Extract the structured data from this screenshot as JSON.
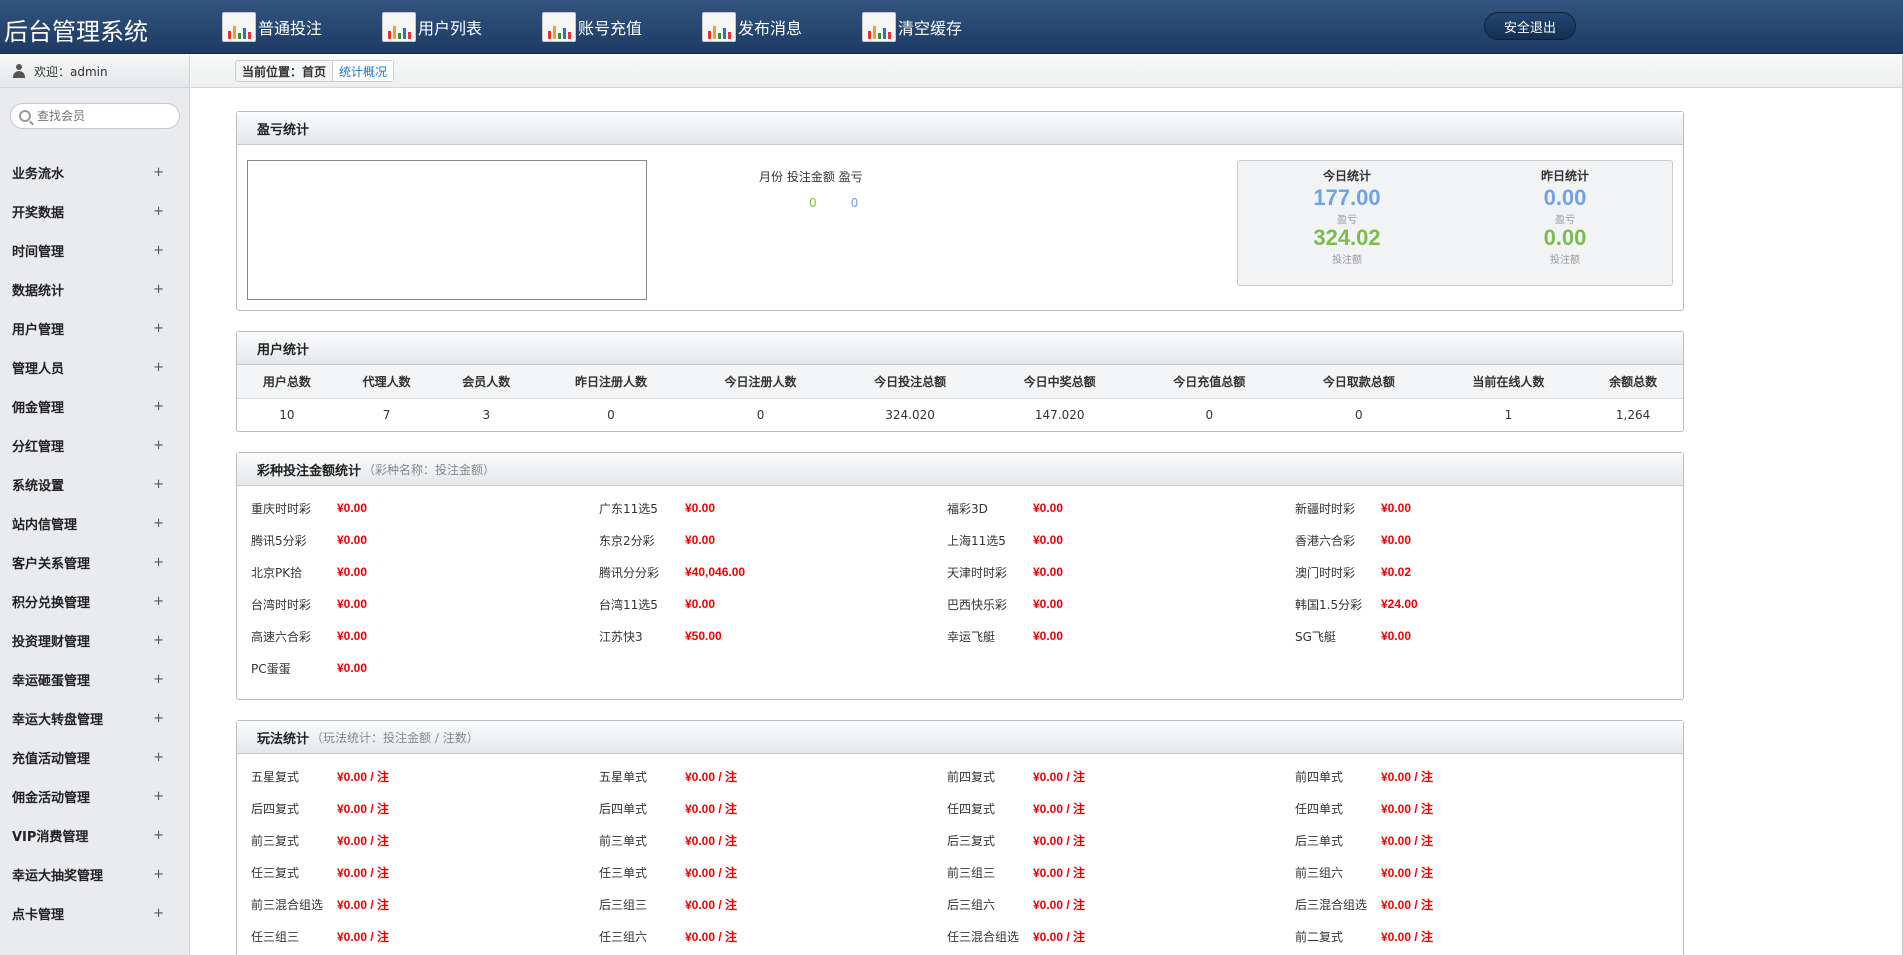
{
  "header": {
    "title": "后台管理系统",
    "nav": [
      {
        "label": "普通投注"
      },
      {
        "label": "用户列表"
      },
      {
        "label": "账号充值"
      },
      {
        "label": "发布消息"
      },
      {
        "label": "清空缓存"
      }
    ],
    "logout_label": "安全退出"
  },
  "sidebar": {
    "welcome": "欢迎：admin",
    "search_placeholder": "查找会员",
    "items": [
      {
        "label": "业务流水"
      },
      {
        "label": "开奖数据"
      },
      {
        "label": "时间管理"
      },
      {
        "label": "数据统计"
      },
      {
        "label": "用户管理"
      },
      {
        "label": "管理人员"
      },
      {
        "label": "佣金管理"
      },
      {
        "label": "分红管理"
      },
      {
        "label": "系统设置"
      },
      {
        "label": "站内信管理"
      },
      {
        "label": "客户关系管理"
      },
      {
        "label": "积分兑换管理"
      },
      {
        "label": "投资理财管理"
      },
      {
        "label": "幸运砸蛋管理"
      },
      {
        "label": "幸运大转盘管理"
      },
      {
        "label": "充值活动管理"
      },
      {
        "label": "佣金活动管理"
      },
      {
        "label": "VIP消费管理"
      },
      {
        "label": "幸运大抽奖管理"
      },
      {
        "label": "点卡管理"
      }
    ],
    "expand_symbol": "+"
  },
  "breadcrumb": {
    "prefix": "当前位置：",
    "home": "首页",
    "current": "统计概况"
  },
  "profit": {
    "title": "盈亏统计",
    "legend": "月份 投注金额 盈亏",
    "legend_bet_value": "0",
    "legend_profit_value": "0",
    "today_title": "今日统计",
    "yesterday_title": "昨日统计",
    "today_profit": "177.00",
    "today_profit_label": "盈亏",
    "today_bet": "324.02",
    "today_bet_label": "投注额",
    "yesterday_profit": "0.00",
    "yesterday_profit_label": "盈亏",
    "yesterday_bet": "0.00",
    "yesterday_bet_label": "投注额",
    "colors": {
      "profit": "#6fa3e8",
      "bet": "#7dbb4f"
    }
  },
  "users": {
    "title": "用户统计",
    "columns": [
      "用户总数",
      "代理人数",
      "会员人数",
      "昨日注册人数",
      "今日注册人数",
      "今日投注总额",
      "今日中奖总额",
      "今日充值总额",
      "今日取款总额",
      "当前在线人数",
      "余额总数"
    ],
    "values": [
      "10",
      "7",
      "3",
      "0",
      "0",
      "324.020",
      "147.020",
      "0",
      "0",
      "1",
      "1,264"
    ]
  },
  "lottery": {
    "title": "彩种投注金额统计",
    "subtitle": "（彩种名称：投注金额）",
    "items": [
      {
        "name": "重庆时时彩",
        "value": "¥0.00"
      },
      {
        "name": "广东11选5",
        "value": "¥0.00"
      },
      {
        "name": "福彩3D",
        "value": "¥0.00"
      },
      {
        "name": "新疆时时彩",
        "value": "¥0.00"
      },
      {
        "name": "腾讯5分彩",
        "value": "¥0.00"
      },
      {
        "name": "东京2分彩",
        "value": "¥0.00"
      },
      {
        "name": "上海11选5",
        "value": "¥0.00"
      },
      {
        "name": "香港六合彩",
        "value": "¥0.00"
      },
      {
        "name": "北京PK拾",
        "value": "¥0.00"
      },
      {
        "name": "腾讯分分彩",
        "value": "¥40,046.00"
      },
      {
        "name": "天津时时彩",
        "value": "¥0.00"
      },
      {
        "name": "澳门时时彩",
        "value": "¥0.02"
      },
      {
        "name": "台湾时时彩",
        "value": "¥0.00"
      },
      {
        "name": "台湾11选5",
        "value": "¥0.00"
      },
      {
        "name": "巴西快乐彩",
        "value": "¥0.00"
      },
      {
        "name": "韩国1.5分彩",
        "value": "¥24.00"
      },
      {
        "name": "高速六合彩",
        "value": "¥0.00"
      },
      {
        "name": "江苏快3",
        "value": "¥50.00"
      },
      {
        "name": "幸运飞艇",
        "value": "¥0.00"
      },
      {
        "name": "SG飞艇",
        "value": "¥0.00"
      },
      {
        "name": "PC蛋蛋",
        "value": "¥0.00"
      }
    ]
  },
  "plays": {
    "title": "玩法统计",
    "subtitle": "（玩法统计：投注金额 / 注数）",
    "items": [
      {
        "name": "五星复式",
        "value": "¥0.00 / 注"
      },
      {
        "name": "五星单式",
        "value": "¥0.00 / 注"
      },
      {
        "name": "前四复式",
        "value": "¥0.00 / 注"
      },
      {
        "name": "前四单式",
        "value": "¥0.00 / 注"
      },
      {
        "name": "后四复式",
        "value": "¥0.00 / 注"
      },
      {
        "name": "后四单式",
        "value": "¥0.00 / 注"
      },
      {
        "name": "任四复式",
        "value": "¥0.00 / 注"
      },
      {
        "name": "任四单式",
        "value": "¥0.00 / 注"
      },
      {
        "name": "前三复式",
        "value": "¥0.00 / 注"
      },
      {
        "name": "前三单式",
        "value": "¥0.00 / 注"
      },
      {
        "name": "后三复式",
        "value": "¥0.00 / 注"
      },
      {
        "name": "后三单式",
        "value": "¥0.00 / 注"
      },
      {
        "name": "任三复式",
        "value": "¥0.00 / 注"
      },
      {
        "name": "任三单式",
        "value": "¥0.00 / 注"
      },
      {
        "name": "前三组三",
        "value": "¥0.00 / 注"
      },
      {
        "name": "前三组六",
        "value": "¥0.00 / 注"
      },
      {
        "name": "前三混合组选",
        "value": "¥0.00 / 注"
      },
      {
        "name": "后三组三",
        "value": "¥0.00 / 注"
      },
      {
        "name": "后三组六",
        "value": "¥0.00 / 注"
      },
      {
        "name": "后三混合组选",
        "value": "¥0.00 / 注"
      },
      {
        "name": "任三组三",
        "value": "¥0.00 / 注"
      },
      {
        "name": "任三组六",
        "value": "¥0.00 / 注"
      },
      {
        "name": "任三混合组选",
        "value": "¥0.00 / 注"
      },
      {
        "name": "前二复式",
        "value": "¥0.00 / 注"
      }
    ]
  }
}
